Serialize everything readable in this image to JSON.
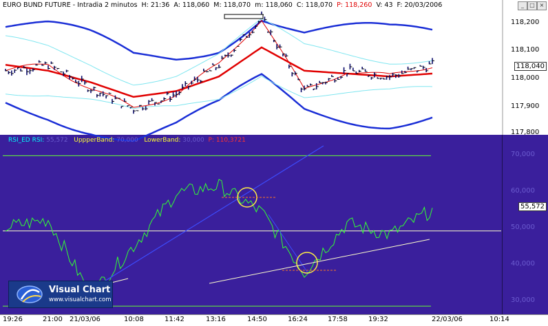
{
  "header": {
    "title": "EURO BUND FUTURE - Intradia 2 minutos",
    "h_label": "H:",
    "h_val": "21:36",
    "a_label": "A:",
    "a_val": "118,060",
    "m_label": "M:",
    "m_val": "118,070",
    "mi_label": "m:",
    "mi_val": "118,060",
    "c_label": "C:",
    "c_val": "118,070",
    "p_label": "P:",
    "p_val": "118,260",
    "v_label": "V:",
    "v_val": "43",
    "f_label": "F:",
    "f_val": "20/03/2006"
  },
  "rsi_header": {
    "rsi_label": "RSI_ED RSI:",
    "rsi_val": "55,572",
    "upper_label": "UppperBand:",
    "upper_val": "70,000",
    "lower_label": "LowerBand:",
    "lower_val": "30,000",
    "p_label": "P:",
    "p_val": "110,3721"
  },
  "price_axis": {
    "ticks": [
      "118,200",
      "118,100",
      "118,000",
      "117,900",
      "117,800"
    ],
    "current": "118,040"
  },
  "rsi_axis": {
    "ticks": [
      "70,000",
      "60,000",
      "50,000",
      "40,000",
      "30,000"
    ],
    "current": "55,572"
  },
  "time_axis": [
    "19:26",
    "21:00",
    "21/03/06",
    "10:08",
    "11:42",
    "13:16",
    "14:50",
    "16:24",
    "17:58",
    "19:32",
    "22/03/06",
    "10:14"
  ],
  "logo": {
    "name": "Visual Chart",
    "url": "www.visualchart.com"
  },
  "colors": {
    "price_bg": "#ffffff",
    "rsi_bg": "#3a1f9c",
    "rsi_line": "#33ff33",
    "band_outer": "#1a2ed6",
    "band_inner": "#7fe6f0",
    "ma": "#e00000"
  },
  "chart_data": [
    {
      "type": "line",
      "title": "EURO BUND FUTURE - Intradia 2 minutos",
      "ylim": [
        117.8,
        118.22
      ],
      "x": [
        "19:26",
        "21:00",
        "21/03/06",
        "10:08",
        "11:42",
        "13:16",
        "14:50",
        "16:24",
        "17:58",
        "19:32",
        "22/03/06"
      ],
      "series": [
        {
          "name": "Price",
          "values": [
            118.02,
            118.04,
            117.96,
            117.89,
            117.94,
            118.04,
            118.2,
            117.95,
            118.02,
            118.0,
            118.04
          ]
        },
        {
          "name": "Moving average",
          "values": [
            118.04,
            118.02,
            117.98,
            117.93,
            117.95,
            118.0,
            118.1,
            118.02,
            118.01,
            118.0,
            118.01
          ]
        }
      ]
    },
    {
      "type": "line",
      "title": "RSI_ED",
      "ylim": [
        28,
        73
      ],
      "x": [
        "19:26",
        "21:00",
        "21/03/06",
        "10:08",
        "11:42",
        "13:16",
        "14:50",
        "16:24",
        "17:58",
        "19:32",
        "22/03/06"
      ],
      "series": [
        {
          "name": "RSI",
          "values": [
            51,
            53,
            33,
            46,
            60,
            62,
            55,
            39,
            52,
            49,
            55.572
          ]
        }
      ],
      "bands": {
        "upper": 70,
        "lower": 30,
        "middle": 50
      }
    }
  ]
}
